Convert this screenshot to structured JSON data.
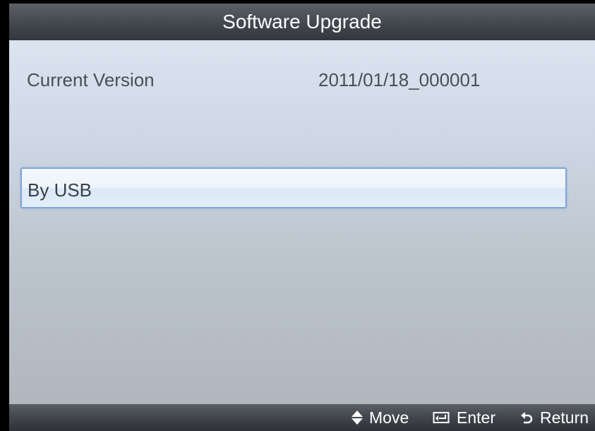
{
  "window": {
    "title": "Software Upgrade"
  },
  "info": {
    "label": "Current Version",
    "value": "2011/01/18_000001"
  },
  "menu": {
    "items": [
      {
        "label": "By USB",
        "selected": true
      }
    ]
  },
  "footer": {
    "move_label": "Move",
    "move_icon": "up-down-arrow-icon",
    "enter_label": "Enter",
    "enter_icon": "enter-icon",
    "return_label": "Return",
    "return_icon": "return-icon"
  },
  "colors": {
    "title_bar": "#474c53",
    "selection_border": "#7fa5d6",
    "text_dark": "#4a4f57"
  }
}
